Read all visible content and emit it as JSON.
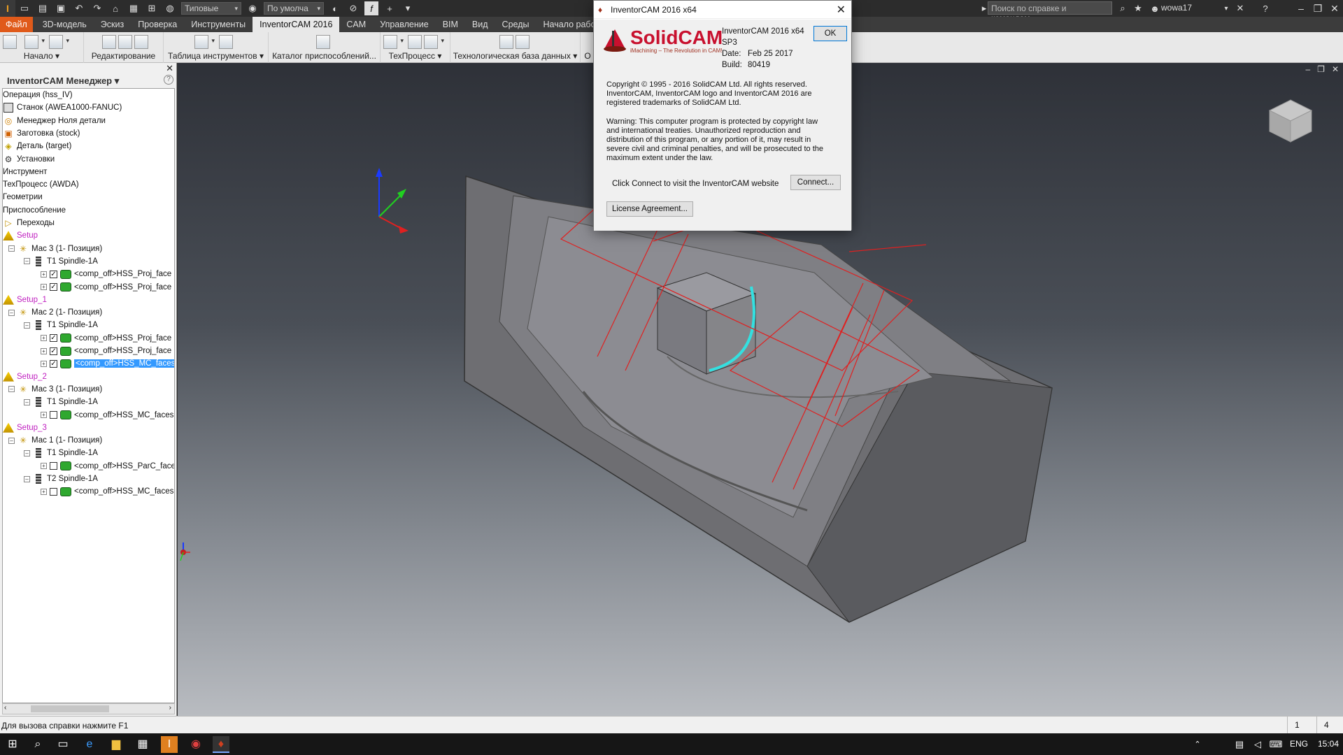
{
  "titlebar": {
    "logo_text": "I",
    "style_select": "Типовые",
    "material_select": "По умолча",
    "search_placeholder": "Поиск по справке и командам...",
    "user": "wowa17"
  },
  "tabs": [
    "Файл",
    "3D-модель",
    "Эскиз",
    "Проверка",
    "Инструменты",
    "InventorCAM 2016",
    "CAM",
    "Управление",
    "BIM",
    "Вид",
    "Среды",
    "Начало работы"
  ],
  "active_tab": "InventorCAM 2016",
  "ribbon_groups": [
    {
      "label": "Начало ▾"
    },
    {
      "label": "Редактирование"
    },
    {
      "label": "Таблица инструментов ▾"
    },
    {
      "label": "Каталог приспособлений..."
    },
    {
      "label": "ТехПроцесс ▾"
    },
    {
      "label": "Технологическая база данных ▾"
    },
    {
      "label": "О"
    }
  ],
  "panel": {
    "title": "InventorCAM Менеджер ▾",
    "close": "✕",
    "help": "?",
    "rows": [
      {
        "label": "Операция (hss_IV)",
        "kind": "plain"
      },
      {
        "label": "Станок (AWEA1000-FANUC)",
        "kind": "machine"
      },
      {
        "label": "Менеджер Ноля детали",
        "kind": "zero"
      },
      {
        "label": "Заготовка (stock)",
        "kind": "stock"
      },
      {
        "label": "Деталь (target)",
        "kind": "target"
      },
      {
        "label": "Установки",
        "kind": "setup-icon"
      },
      {
        "label": "Инструмент",
        "kind": "plain"
      },
      {
        "label": "ТехПроцесс (AWDA)",
        "kind": "plain"
      },
      {
        "label": "Геометрии",
        "kind": "plain"
      },
      {
        "label": "Приспособление",
        "kind": "plain"
      },
      {
        "label": "Переходы",
        "kind": "folder"
      },
      {
        "label": "Setup",
        "kind": "setup"
      },
      {
        "label": "Мас 3 (1- Позиция)",
        "kind": "mac"
      },
      {
        "label": "T1 Spindle-1A",
        "kind": "tool"
      },
      {
        "label": "<comp_off>HSS_Proj_face",
        "kind": "op",
        "checked": true
      },
      {
        "label": "<comp_off>HSS_Proj_face",
        "kind": "op",
        "checked": true
      },
      {
        "label": "Setup_1",
        "kind": "setup"
      },
      {
        "label": "Мас 2 (1- Позиция)",
        "kind": "mac"
      },
      {
        "label": "T1 Spindle-1A",
        "kind": "tool"
      },
      {
        "label": "<comp_off>HSS_Proj_face",
        "kind": "op",
        "checked": true
      },
      {
        "label": "<comp_off>HSS_Proj_face",
        "kind": "op",
        "checked": true
      },
      {
        "label": "<comp_off>HSS_MC_faces",
        "kind": "op",
        "checked": true,
        "selected": true
      },
      {
        "label": "Setup_2",
        "kind": "setup"
      },
      {
        "label": "Мас 3 (1- Позиция)",
        "kind": "mac"
      },
      {
        "label": "T1 Spindle-1A",
        "kind": "tool"
      },
      {
        "label": "<comp_off>HSS_MC_faces",
        "kind": "op",
        "checked": false
      },
      {
        "label": "Setup_3",
        "kind": "setup"
      },
      {
        "label": "Мас 1 (1- Позиция)",
        "kind": "mac"
      },
      {
        "label": "T1 Spindle-1A",
        "kind": "tool"
      },
      {
        "label": "<comp_off>HSS_ParC_face",
        "kind": "op",
        "checked": false
      },
      {
        "label": "T2 Spindle-1A",
        "kind": "tool"
      },
      {
        "label": "<comp_off>HSS_MC_faces",
        "kind": "op",
        "checked": false
      }
    ]
  },
  "statusbar": {
    "text": "Для вызова справки нажмите F1",
    "cell1": "1",
    "cell2": "4"
  },
  "taskbar": {
    "lang": "ENG",
    "time": "15:04"
  },
  "dialog": {
    "title": "InventorCAM 2016 x64",
    "logo_word": "SolidCAM",
    "logo_tagline": "iMachining – The Revolution in CAM!",
    "product": "InventorCAM 2016 x64",
    "sp": "SP3",
    "date_label": "Date:",
    "date_value": "Feb 25 2017",
    "build_label": "Build:",
    "build_value": "80419",
    "copyright": "Copyright © 1995 - 2016 SolidCAM Ltd. All rights reserved. InventorCAM, InventorCAM logo and InventorCAM 2016 are registered trademarks of SolidCAM Ltd.",
    "warning": "Warning: This computer program is protected by copyright law and international treaties. Unauthorized reproduction and distribution of this program, or any portion of it, may result in severe civil and criminal penalties, and will be prosecuted to the maximum extent under the law.",
    "connect_text": "Click Connect to visit the InventorCAM website",
    "ok": "OK",
    "connect": "Connect...",
    "license": "License Agreement..."
  },
  "colors": {
    "file_tab": "#e05a1a",
    "setup_text": "#c020c0",
    "selection": "#3399ff",
    "toolpath": "#e02020",
    "highlight_edge": "#33e0e0"
  }
}
